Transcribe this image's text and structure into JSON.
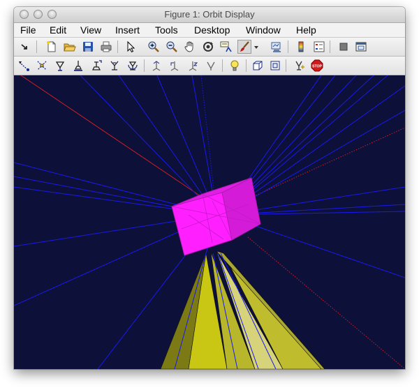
{
  "window": {
    "title": "Figure 1: Orbit Display"
  },
  "menu": [
    "File",
    "Edit",
    "View",
    "Insert",
    "Tools",
    "Desktop",
    "Window",
    "Help"
  ],
  "toolbar1_icons": [
    "dock-icon",
    "new-figure-icon",
    "open-file-icon",
    "save-icon",
    "print-icon",
    "select-pointer-icon",
    "zoom-in-icon",
    "zoom-out-icon",
    "pan-hand-icon",
    "rotate-3d-icon",
    "data-cursor-icon",
    "brush-icon",
    "brush-dropdown-icon",
    "link-plot-icon",
    "colorbar-icon",
    "legend-icon",
    "hide-plot-tools-icon",
    "show-plot-tools-icon"
  ],
  "toolbar2_icons": [
    "orbit-camera-icon",
    "orbit-light-icon",
    "pan-tilt-camera-icon",
    "move-camera-icon",
    "move-camera-forward-icon",
    "zoom-camera-icon",
    "roll-camera-icon",
    "principal-axis-x-icon",
    "principal-axis-y-icon",
    "principal-axis-z-icon",
    "no-axis-icon",
    "scene-light-icon",
    "perspective-projection-icon",
    "orthographic-projection-icon",
    "reset-camera-icon",
    "stop-camera-icon"
  ],
  "colors": {
    "plot_background": "#0d1038",
    "cube": "#ff1fff",
    "cube_edge": "#b31ab3",
    "ray_lines": "#1a1aee",
    "red_lines": "#e02020",
    "cone_dark": "#7b7a14",
    "cone_mid": "#c9c713",
    "cone_light": "#d7d37a"
  }
}
